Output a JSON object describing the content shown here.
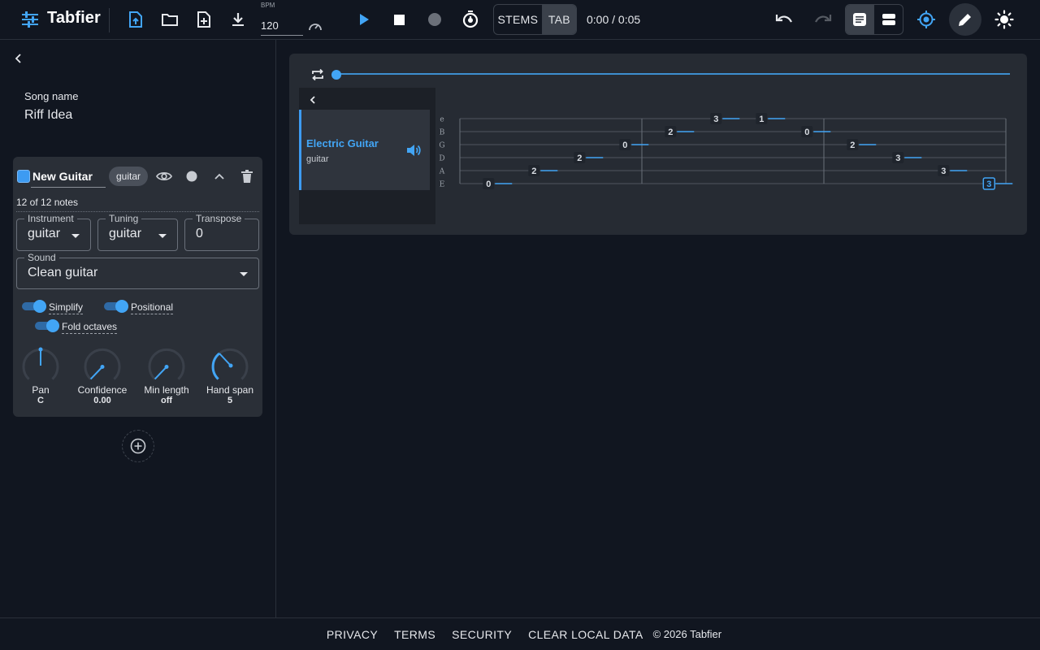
{
  "app": {
    "name": "Tabfier"
  },
  "toolbar": {
    "bpm_label": "BPM",
    "bpm_value": "120",
    "mode_stems": "STEMS",
    "mode_tab": "TAB",
    "time": "0:00 / 0:05",
    "active_mode": "TAB"
  },
  "sidebar": {
    "song_label": "Song name",
    "song_name": "Riff Idea",
    "track": {
      "name": "New Guitar",
      "chip": "guitar",
      "notes": "12 of 12 notes",
      "instrument_label": "Instrument",
      "instrument_value": "guitar",
      "tuning_label": "Tuning",
      "tuning_value": "guitar",
      "transpose_label": "Transpose",
      "transpose_value": "0",
      "sound_label": "Sound",
      "sound_value": "Clean guitar",
      "toggles": [
        {
          "label": "Simplify",
          "on": true
        },
        {
          "label": "Positional",
          "on": true
        },
        {
          "label": "Fold octaves",
          "on": true
        }
      ],
      "knobs": [
        {
          "label": "Pan",
          "value": "C"
        },
        {
          "label": "Confidence",
          "value": "0.00"
        },
        {
          "label": "Min length",
          "value": "off"
        },
        {
          "label": "Hand span",
          "value": "5"
        }
      ]
    }
  },
  "main": {
    "track_list": [
      {
        "name": "Electric Guitar",
        "sub": "guitar"
      }
    ],
    "tab": {
      "string_names": [
        "e",
        "B",
        "G",
        "D",
        "A",
        "E"
      ],
      "notes": [
        {
          "string": "E",
          "fret": "0"
        },
        {
          "string": "A",
          "fret": "2"
        },
        {
          "string": "D",
          "fret": "2"
        },
        {
          "string": "G",
          "fret": "0"
        },
        {
          "string": "B",
          "fret": "2"
        },
        {
          "string": "e",
          "fret": "3"
        },
        {
          "string": "e",
          "fret": "1"
        },
        {
          "string": "B",
          "fret": "0"
        },
        {
          "string": "G",
          "fret": "2"
        },
        {
          "string": "D",
          "fret": "3"
        },
        {
          "string": "A",
          "fret": "3"
        },
        {
          "string": "E",
          "fret": "3",
          "selected": true
        }
      ]
    }
  },
  "footer": {
    "links": [
      "PRIVACY",
      "TERMS",
      "SECURITY",
      "CLEAR LOCAL DATA"
    ],
    "copyright": "© 2026 Tabfier"
  },
  "colors": {
    "background": "#111620",
    "panel": "#262b33",
    "accent": "#42a5f5",
    "text": "#e6e8ec"
  },
  "icons": [
    "sliders-icon",
    "upload-icon",
    "folder-icon",
    "new-file-icon",
    "download-icon",
    "speedometer-icon",
    "play-icon",
    "stop-icon",
    "record-icon",
    "timer-icon",
    "undo-icon",
    "redo-icon",
    "view-notes-icon",
    "view-lanes-icon",
    "target-icon",
    "pencil-icon",
    "brightness-icon",
    "chevron-left-icon",
    "eye-icon",
    "circle-icon",
    "chevron-up-icon",
    "trash-icon",
    "add-circle-icon",
    "loop-icon",
    "speaker-icon"
  ]
}
